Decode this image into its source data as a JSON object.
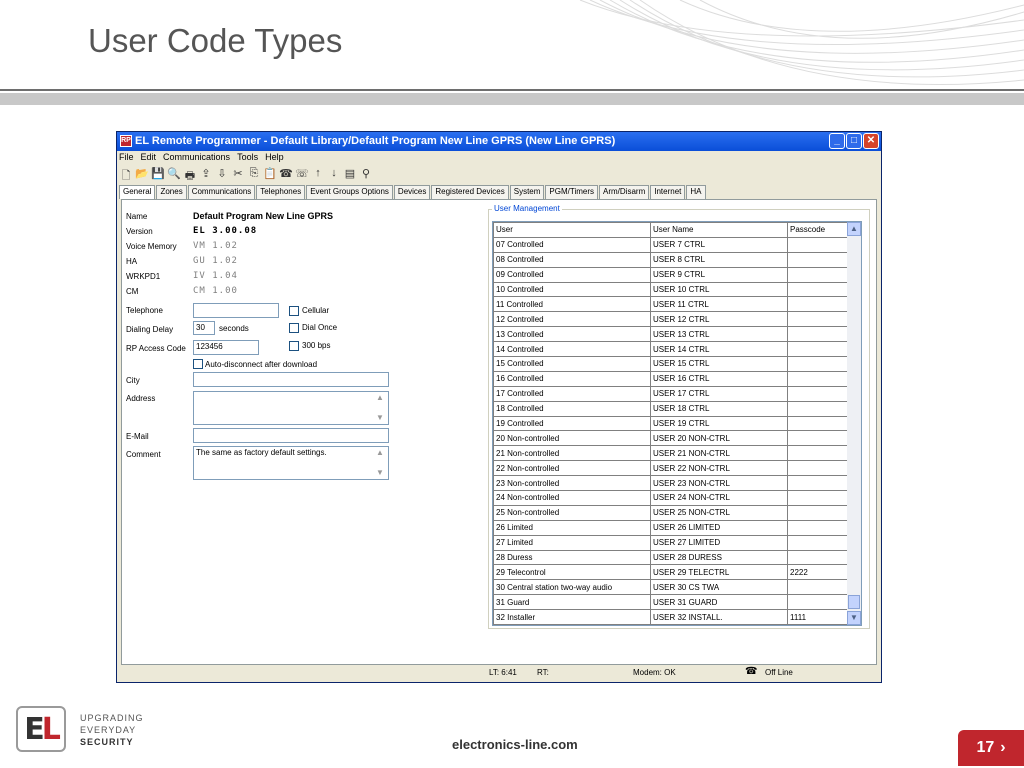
{
  "slide": {
    "title": "User Code Types",
    "footer_url": "electronics-line.com",
    "page_number": "17",
    "tagline": [
      "UPGRADING",
      "EVERYDAY",
      "SECURITY"
    ],
    "logo_text": "EL"
  },
  "window": {
    "title": "EL Remote Programmer - Default Library/Default Program New Line GPRS (New Line GPRS)",
    "menu": [
      "File",
      "Edit",
      "Communications",
      "Tools",
      "Help"
    ],
    "tabs": [
      "General",
      "Zones",
      "Communications",
      "Telephones",
      "Event Groups Options",
      "Devices",
      "Registered Devices",
      "System",
      "PGM/Timers",
      "Arm/Disarm",
      "Internet",
      "HA"
    ],
    "active_tab": "General"
  },
  "general": {
    "name_label": "Name",
    "name_value": "Default Program New Line GPRS",
    "version_label": "Version",
    "version_value": "EL  3.00.08",
    "voice_label": "Voice Memory",
    "voice_value": "VM  1.02",
    "ha_label": "HA",
    "ha_value": "GU  1.02",
    "wrkpd_label": "WRKPD1",
    "wrkpd_value": "IV  1.04",
    "cm_label": "CM",
    "cm_value": "CM  1.00",
    "telephone_label": "Telephone",
    "telephone_value": "",
    "cellular_label": "Cellular",
    "dialing_delay_label": "Dialing Delay",
    "dialing_delay_value": "30",
    "seconds_label": "seconds",
    "dial_once_label": "Dial Once",
    "rp_access_label": "RP Access Code",
    "rp_access_value": "123456",
    "bps_label": "300 bps",
    "auto_disconnect_label": "Auto-disconnect after download",
    "city_label": "City",
    "city_value": "",
    "address_label": "Address",
    "address_value": "",
    "email_label": "E-Mail",
    "email_value": "",
    "comment_label": "Comment",
    "comment_value": "The same as factory default settings."
  },
  "user_management": {
    "title": "User Management",
    "columns": [
      "User",
      "User Name",
      "Passcode"
    ],
    "rows": [
      [
        "07 Controlled",
        "USER 7 CTRL",
        ""
      ],
      [
        "08 Controlled",
        "USER 8 CTRL",
        ""
      ],
      [
        "09 Controlled",
        "USER 9 CTRL",
        ""
      ],
      [
        "10 Controlled",
        "USER 10 CTRL",
        ""
      ],
      [
        "11 Controlled",
        "USER 11 CTRL",
        ""
      ],
      [
        "12 Controlled",
        "USER 12 CTRL",
        ""
      ],
      [
        "13 Controlled",
        "USER 13 CTRL",
        ""
      ],
      [
        "14 Controlled",
        "USER 14 CTRL",
        ""
      ],
      [
        "15 Controlled",
        "USER 15 CTRL",
        ""
      ],
      [
        "16 Controlled",
        "USER 16 CTRL",
        ""
      ],
      [
        "17 Controlled",
        "USER 17 CTRL",
        ""
      ],
      [
        "18 Controlled",
        "USER 18 CTRL",
        ""
      ],
      [
        "19 Controlled",
        "USER 19 CTRL",
        ""
      ],
      [
        "20 Non-controlled",
        "USER 20 NON-CTRL",
        ""
      ],
      [
        "21 Non-controlled",
        "USER 21 NON-CTRL",
        ""
      ],
      [
        "22 Non-controlled",
        "USER 22 NON-CTRL",
        ""
      ],
      [
        "23 Non-controlled",
        "USER 23 NON-CTRL",
        ""
      ],
      [
        "24 Non-controlled",
        "USER 24 NON-CTRL",
        ""
      ],
      [
        "25 Non-controlled",
        "USER 25 NON-CTRL",
        ""
      ],
      [
        "26 Limited",
        "USER 26 LIMITED",
        ""
      ],
      [
        "27 Limited",
        "USER 27 LIMITED",
        ""
      ],
      [
        "28 Duress",
        "USER 28 DURESS",
        ""
      ],
      [
        "29 Telecontrol",
        "USER 29 TELECTRL",
        "2222"
      ],
      [
        "30 Central station two-way audio",
        "USER 30 CS TWA",
        ""
      ],
      [
        "31 Guard",
        "USER 31 GUARD",
        ""
      ],
      [
        "32 Installer",
        "USER 32 INSTALL.",
        "1111"
      ]
    ]
  },
  "status_bar": {
    "lt": "LT: 6:41",
    "rt": "RT:",
    "modem": "Modem: OK",
    "line": "Off Line"
  }
}
